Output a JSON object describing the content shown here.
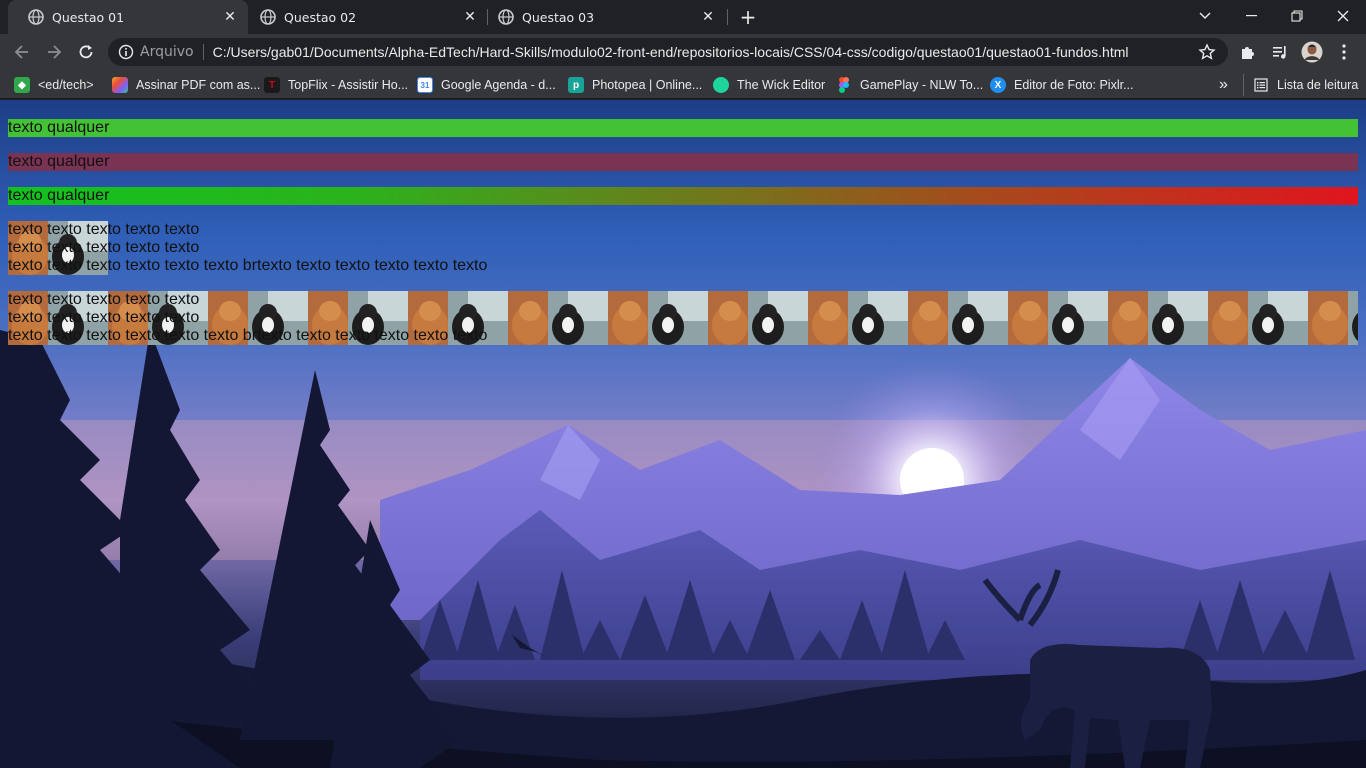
{
  "browser": {
    "tabs": [
      {
        "title": "Questao 01",
        "active": true,
        "icon": "globe-icon"
      },
      {
        "title": "Questao 02",
        "active": false,
        "icon": "globe-icon"
      },
      {
        "title": "Questao 03",
        "active": false,
        "icon": "globe-icon"
      }
    ],
    "new_tab_label": "+",
    "omnibox": {
      "scheme_label": "Arquivo",
      "url": "C:/Users/gab01/Documents/Alpha-EdTech/Hard-Skills/modulo02-front-end/repositorios-locais/CSS/04-css/codigo/questao01/questao01-fundos.html"
    },
    "bookmarks": [
      {
        "label": "<ed/tech>",
        "icon": "edtech-icon",
        "color": "#2ea84a"
      },
      {
        "label": "Assinar PDF com as...",
        "icon": "pdf-sign-icon",
        "color": "#e94e3c"
      },
      {
        "label": "TopFlix - Assistir Ho...",
        "icon": "topflix-icon",
        "color": "#d0021b"
      },
      {
        "label": "Google Agenda - d...",
        "icon": "calendar-icon",
        "color": "#4285f4"
      },
      {
        "label": "Photopea | Online...",
        "icon": "photopea-icon",
        "color": "#18a497"
      },
      {
        "label": "The Wick Editor",
        "icon": "wick-icon",
        "color": "#1fd49a"
      },
      {
        "label": "GamePlay - NLW To...",
        "icon": "figma-icon",
        "color": "#f24e1e"
      },
      {
        "label": "Editor de Foto: Pixlr...",
        "icon": "pixlr-icon",
        "color": "#1f8ef1"
      }
    ],
    "reading_list_label": "Lista de leitura",
    "overflow_label": "»"
  },
  "page": {
    "bar1_text": "texto qualquer",
    "bar2_text": "texto qualquer",
    "bar3_text": "texto qualquer",
    "block1_lines": [
      "texto texto texto texto texto",
      "texto texto texto texto texto",
      "texto texto texto texto texto texto brtexto texto texto texto texto texto"
    ],
    "block2_lines": [
      "texto texto texto texto texto",
      "texto texto texto texto texto",
      "texto texto texto texto texto texto brtexto texto texto texto texto texto"
    ]
  },
  "colors": {
    "bar1": "#44c235",
    "bar2": "#7a3352",
    "bar3_start": "#12c21e",
    "bar3_end": "#e0151e"
  }
}
